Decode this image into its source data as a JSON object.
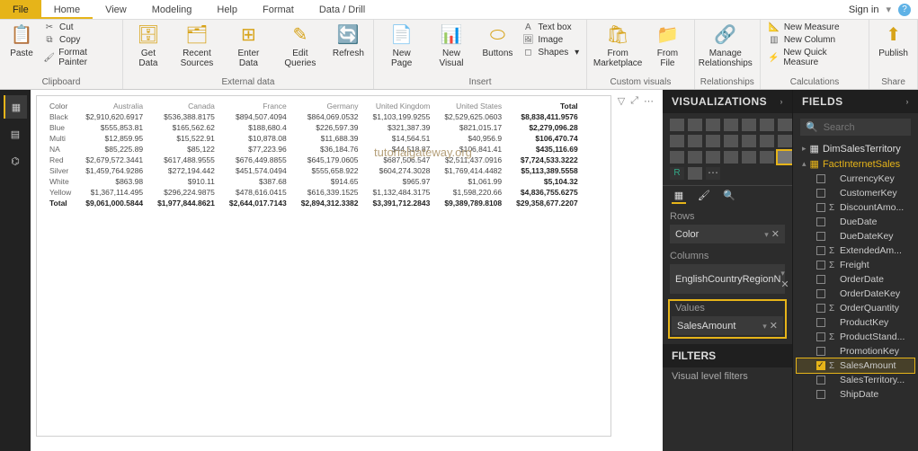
{
  "tabs": {
    "file": "File",
    "home": "Home",
    "view": "View",
    "modeling": "Modeling",
    "help": "Help",
    "format": "Format",
    "datadrill": "Data / Drill",
    "signin": "Sign in"
  },
  "ribbon": {
    "clipboard": {
      "label": "Clipboard",
      "paste": "Paste",
      "cut": "Cut",
      "copy": "Copy",
      "painter": "Format Painter"
    },
    "external": {
      "label": "External data",
      "getdata": "Get\nData",
      "recent": "Recent\nSources",
      "enter": "Enter\nData",
      "edit": "Edit\nQueries",
      "refresh": "Refresh"
    },
    "insert": {
      "label": "Insert",
      "newpage": "New\nPage",
      "newvisual": "New\nVisual",
      "buttons": "Buttons",
      "textbox": "Text box",
      "image": "Image",
      "shapes": "Shapes"
    },
    "custom": {
      "label": "Custom visuals",
      "market": "From\nMarketplace",
      "file": "From\nFile"
    },
    "rel": {
      "label": "Relationships",
      "manage": "Manage\nRelationships"
    },
    "calc": {
      "label": "Calculations",
      "newmeasure": "New Measure",
      "newcolumn": "New Column",
      "quick": "New Quick Measure"
    },
    "share": {
      "label": "Share",
      "publish": "Publish"
    }
  },
  "watermark": "tutorialgateway.org",
  "matrix": {
    "columns": [
      "Color",
      "Australia",
      "Canada",
      "France",
      "Germany",
      "United Kingdom",
      "United States",
      "Total"
    ],
    "rows": [
      [
        "Black",
        "$2,910,620.6917",
        "$536,388.8175",
        "$894,507.4094",
        "$864,069.0532",
        "$1,103,199.9255",
        "$2,529,625.0603",
        "$8,838,411.9576"
      ],
      [
        "Blue",
        "$555,853.81",
        "$165,562.62",
        "$188,680.4",
        "$226,597.39",
        "$321,387.39",
        "$821,015.17",
        "$2,279,096.28"
      ],
      [
        "Multi",
        "$12,859.95",
        "$15,522.91",
        "$10,878.08",
        "$11,688.39",
        "$14,564.51",
        "$40,956.9",
        "$106,470.74"
      ],
      [
        "NA",
        "$85,225.89",
        "$85,122",
        "$77,223.96",
        "$36,184.76",
        "$44,518.87",
        "$106,841.41",
        "$435,116.69"
      ],
      [
        "Red",
        "$2,679,572.3441",
        "$617,488.9555",
        "$676,449.8855",
        "$645,179.0605",
        "$687,506.547",
        "$2,511,437.0916",
        "$7,724,533.3222"
      ],
      [
        "Silver",
        "$1,459,764.9286",
        "$272,194.442",
        "$451,574.0494",
        "$555,658.922",
        "$604,274.3028",
        "$1,769,414.4482",
        "$5,113,389.5558"
      ],
      [
        "White",
        "$863.98",
        "$910.11",
        "$387.68",
        "$914.65",
        "$965.97",
        "$1,061.99",
        "$5,104.32"
      ],
      [
        "Yellow",
        "$1,367,114.495",
        "$296,224.9875",
        "$478,616.0415",
        "$616,339.1525",
        "$1,132,484.3175",
        "$1,598,220.66",
        "$4,836,755.6275"
      ],
      [
        "Total",
        "$9,061,000.5844",
        "$1,977,844.8621",
        "$2,644,017.7143",
        "$2,894,312.3382",
        "$3,391,712.2843",
        "$9,389,789.8108",
        "$29,358,677.2207"
      ]
    ]
  },
  "vis": {
    "title": "VISUALIZATIONS",
    "wells": {
      "rows": "Rows",
      "rows_field": "Color",
      "columns": "Columns",
      "columns_field": "EnglishCountryRegionN",
      "values": "Values",
      "values_field": "SalesAmount"
    },
    "filters": "FILTERS",
    "vlf": "Visual level filters"
  },
  "fields": {
    "title": "FIELDS",
    "search": "Search",
    "tables": {
      "dim": "DimSalesTerritory",
      "fact": "FactInternetSales"
    },
    "factFields": [
      {
        "name": "CurrencyKey",
        "sigma": false,
        "checked": false
      },
      {
        "name": "CustomerKey",
        "sigma": false,
        "checked": false
      },
      {
        "name": "DiscountAmo...",
        "sigma": true,
        "checked": false
      },
      {
        "name": "DueDate",
        "sigma": false,
        "checked": false
      },
      {
        "name": "DueDateKey",
        "sigma": false,
        "checked": false
      },
      {
        "name": "ExtendedAm...",
        "sigma": true,
        "checked": false
      },
      {
        "name": "Freight",
        "sigma": true,
        "checked": false
      },
      {
        "name": "OrderDate",
        "sigma": false,
        "checked": false
      },
      {
        "name": "OrderDateKey",
        "sigma": false,
        "checked": false
      },
      {
        "name": "OrderQuantity",
        "sigma": true,
        "checked": false
      },
      {
        "name": "ProductKey",
        "sigma": false,
        "checked": false
      },
      {
        "name": "ProductStand...",
        "sigma": true,
        "checked": false
      },
      {
        "name": "PromotionKey",
        "sigma": false,
        "checked": false
      },
      {
        "name": "SalesAmount",
        "sigma": true,
        "checked": true,
        "hl": true
      },
      {
        "name": "SalesTerritory...",
        "sigma": false,
        "checked": false
      },
      {
        "name": "ShipDate",
        "sigma": false,
        "checked": false
      }
    ]
  }
}
